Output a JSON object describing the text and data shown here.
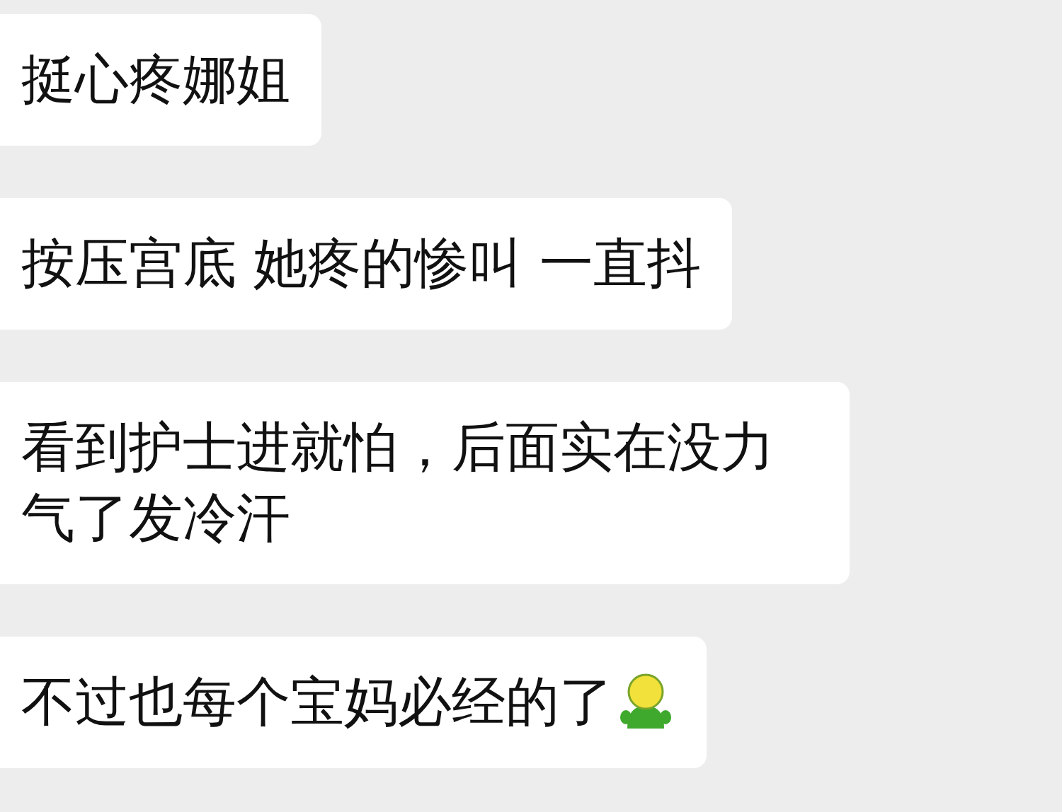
{
  "messages": [
    {
      "text": "挺心疼娜姐"
    },
    {
      "text": "按压宫底 她疼的惨叫 一直抖"
    },
    {
      "text": "看到护士进就怕，后面实在没力气了发冷汗"
    },
    {
      "text": "不过也每个宝妈必经的了",
      "sticker": true
    }
  ]
}
